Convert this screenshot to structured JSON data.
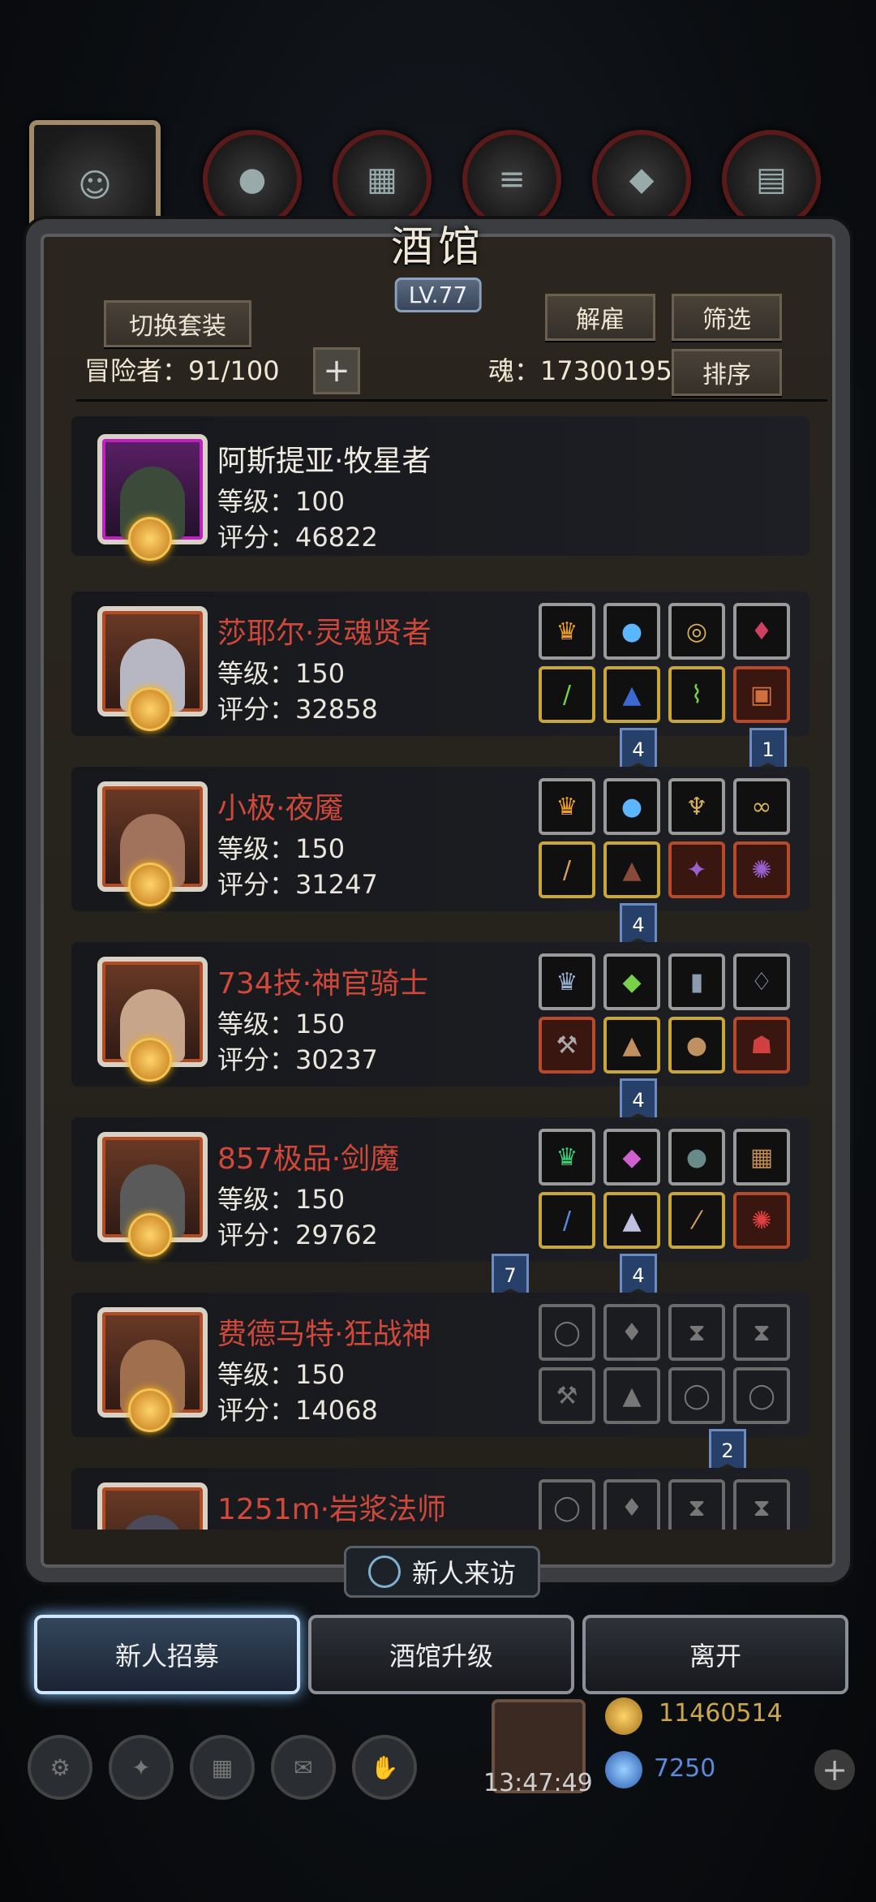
{
  "header": {
    "title": "酒馆",
    "level": "LV.77",
    "switch_label": "切换套装",
    "dismiss_label": "解雇",
    "filter_label": "筛选",
    "sort_label": "排序",
    "adventurers_label": "冒险者：91/100",
    "soul_label": "魂：17300195"
  },
  "heroes": [
    {
      "name": "阿斯提亚·牧星者",
      "level": "等级：100",
      "score": "评分：46822",
      "name_color": "#f1ece1",
      "avatar": "purple"
    },
    {
      "name": "莎耶尔·灵魂贤者",
      "level": "等级：150",
      "score": "评分：32858",
      "name_color": "#d0483a",
      "avatar": "orange"
    },
    {
      "name": "小极·夜魇",
      "level": "等级：150",
      "score": "评分：31247",
      "name_color": "#d0483a",
      "avatar": "orange"
    },
    {
      "name": "734技·神官骑士",
      "level": "等级：150",
      "score": "评分：30237",
      "name_color": "#d0483a",
      "avatar": "orange"
    },
    {
      "name": "857极品·剑魔",
      "level": "等级：150",
      "score": "评分：29762",
      "name_color": "#d0483a",
      "avatar": "orange"
    },
    {
      "name": "费德马特·狂战神",
      "level": "等级：150",
      "score": "评分：14068",
      "name_color": "#d0483a",
      "avatar": "orange"
    },
    {
      "name": "1251m·岩浆法师",
      "level": "",
      "score": "",
      "name_color": "#d0483a",
      "avatar": "orange"
    }
  ],
  "flags": [
    "4",
    "1",
    "4",
    "4",
    "7",
    "4",
    "2"
  ],
  "visit_label": "新人来访",
  "bottom": {
    "recruit": "新人招募",
    "upgrade": "酒馆升级",
    "leave": "离开"
  },
  "resources": {
    "gold": "11460514",
    "gem": "7250",
    "timer": "13:47:49"
  }
}
